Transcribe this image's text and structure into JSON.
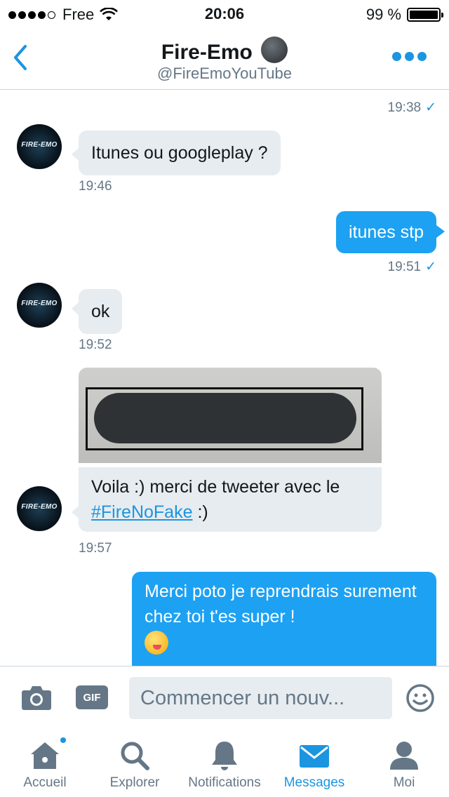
{
  "status_bar": {
    "carrier": "Free",
    "time": "20:06",
    "battery_percent": "99 %",
    "battery_level": 0.99,
    "signal_bars": 4,
    "signal_total": 5
  },
  "header": {
    "back_icon": "chevron-left-icon",
    "title": "Fire-Emo",
    "title_emoji": "new-moon-face-emoji",
    "handle": "@FireEmoYouTube",
    "more_icon": "more-dots-icon"
  },
  "conversation": {
    "sender_avatar_text": "FIRE-EMO",
    "messages": [
      {
        "type": "meta",
        "time": "19:38",
        "read": true
      },
      {
        "type": "incoming",
        "text": "Itunes ou googleplay ?",
        "time": "19:46"
      },
      {
        "type": "outgoing",
        "text": "itunes stp",
        "time": "19:51",
        "read": true
      },
      {
        "type": "incoming",
        "text": "ok",
        "time": "19:52"
      },
      {
        "type": "incoming",
        "text_before": "Voila :) merci de tweeter avec le ",
        "hashtag": "#FireNoFake",
        "text_after": " :)",
        "time": "19:57",
        "has_image": true
      },
      {
        "type": "outgoing",
        "text": "Merci poto je reprendrais surement chez toi t'es super !",
        "emoji": "yum-face-emoji"
      }
    ],
    "colors": {
      "incoming_bubble": "#e6ecf0",
      "outgoing_bubble": "#1da1f2",
      "accent": "#1b95e0"
    }
  },
  "compose": {
    "camera_icon": "camera-icon",
    "gif_label": "GIF",
    "placeholder": "Commencer un nouv...",
    "emoji_icon": "smiley-icon"
  },
  "tabbar": {
    "tabs": [
      {
        "label": "Accueil",
        "icon": "home-icon",
        "active": false,
        "badge": true
      },
      {
        "label": "Explorer",
        "icon": "search-icon",
        "active": false
      },
      {
        "label": "Notifications",
        "icon": "bell-icon",
        "active": false
      },
      {
        "label": "Messages",
        "icon": "envelope-icon",
        "active": true
      },
      {
        "label": "Moi",
        "icon": "person-icon",
        "active": false
      }
    ]
  }
}
